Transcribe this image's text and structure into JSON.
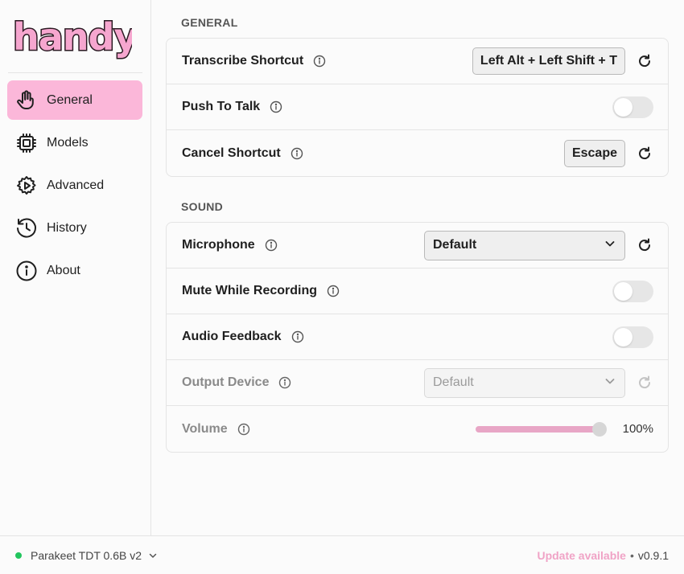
{
  "app": {
    "logo_text": "handy"
  },
  "sidebar": {
    "items": [
      {
        "label": "General",
        "icon": "hand-icon",
        "active": true
      },
      {
        "label": "Models",
        "icon": "cpu-icon",
        "active": false
      },
      {
        "label": "Advanced",
        "icon": "gear-play-icon",
        "active": false
      },
      {
        "label": "History",
        "icon": "history-icon",
        "active": false
      },
      {
        "label": "About",
        "icon": "info-circle-icon",
        "active": false
      }
    ]
  },
  "general": {
    "title": "GENERAL",
    "transcribe_shortcut": {
      "label": "Transcribe Shortcut",
      "value": "Left Alt + Left Shift + T"
    },
    "push_to_talk": {
      "label": "Push To Talk",
      "enabled": false
    },
    "cancel_shortcut": {
      "label": "Cancel Shortcut",
      "value": "Escape"
    }
  },
  "sound": {
    "title": "SOUND",
    "microphone": {
      "label": "Microphone",
      "value": "Default"
    },
    "mute_while_recording": {
      "label": "Mute While Recording",
      "enabled": false
    },
    "audio_feedback": {
      "label": "Audio Feedback",
      "enabled": false
    },
    "output_device": {
      "label": "Output Device",
      "value": "Default",
      "disabled": true
    },
    "volume": {
      "label": "Volume",
      "value": "100%",
      "level": 1.0
    }
  },
  "footer": {
    "model": "Parakeet TDT 0.6B v2",
    "status_color": "#22c55e",
    "update": "Update available",
    "separator": "•",
    "version": "v0.9.1"
  },
  "colors": {
    "accent": "#fbb7d9",
    "slider": "#e8a6c6",
    "update_text": "#f0a3c6"
  }
}
